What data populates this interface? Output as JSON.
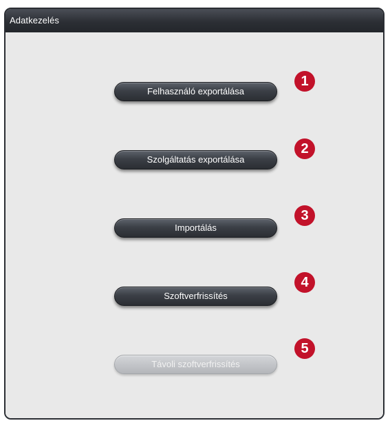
{
  "window": {
    "title": "Adatkezelés"
  },
  "buttons": [
    {
      "label": "Felhasználó exportálása",
      "marker": "1",
      "enabled": true
    },
    {
      "label": "Szolgáltatás exportálása",
      "marker": "2",
      "enabled": true
    },
    {
      "label": "Importálás",
      "marker": "3",
      "enabled": true
    },
    {
      "label": "Szoftverfrissítés",
      "marker": "4",
      "enabled": true
    },
    {
      "label": "Távoli szoftverfrissítés",
      "marker": "5",
      "enabled": false
    }
  ],
  "colors": {
    "titlebar": "#2c2f35",
    "button_enabled": "#3b3f46",
    "button_disabled": "#c3c5c9",
    "marker": "#c2122a",
    "panel": "#e9e9e9"
  }
}
